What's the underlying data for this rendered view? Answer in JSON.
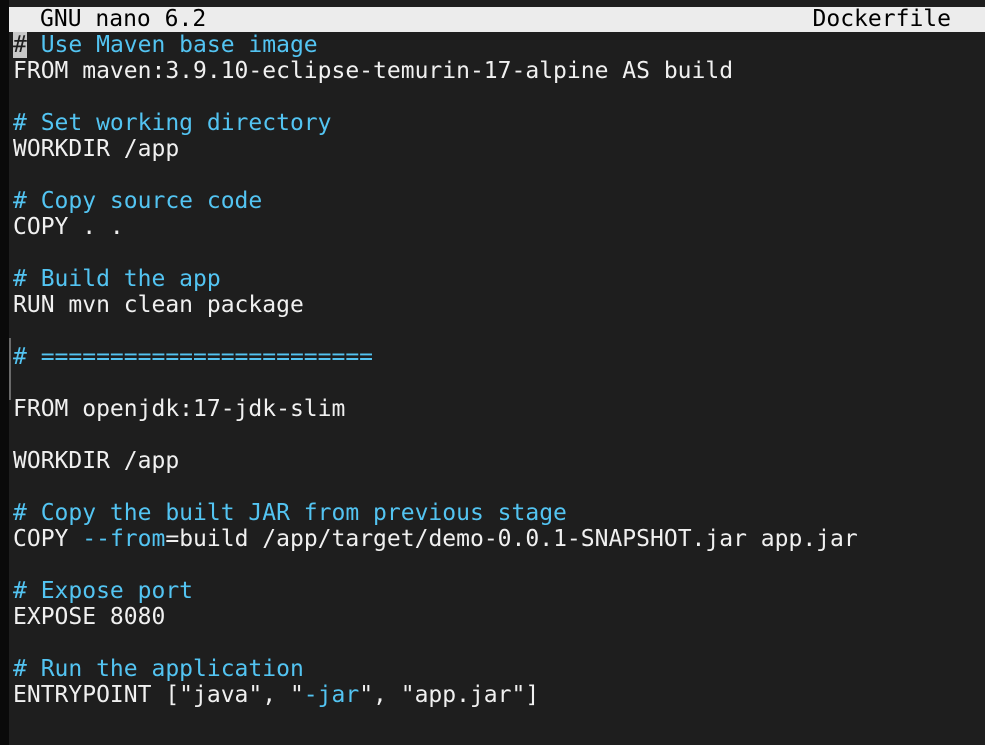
{
  "title_bar": {
    "app": "GNU nano 6.2",
    "file": "Dockerfile"
  },
  "editor": {
    "lines": [
      {
        "type": "comment",
        "cursor": "#",
        "text": " Use Maven base image"
      },
      {
        "type": "code",
        "text": "FROM maven:3.9.10-eclipse-temurin-17-alpine AS build"
      },
      {
        "type": "blank",
        "text": ""
      },
      {
        "type": "comment",
        "text": "# Set working directory"
      },
      {
        "type": "code",
        "text": "WORKDIR /app"
      },
      {
        "type": "blank",
        "text": ""
      },
      {
        "type": "comment",
        "text": "# Copy source code"
      },
      {
        "type": "code",
        "text": "COPY . ."
      },
      {
        "type": "blank",
        "text": ""
      },
      {
        "type": "comment",
        "text": "# Build the app"
      },
      {
        "type": "code",
        "text": "RUN mvn clean package"
      },
      {
        "type": "blank",
        "text": ""
      },
      {
        "type": "comment",
        "text": "# ========================"
      },
      {
        "type": "blank",
        "text": ""
      },
      {
        "type": "code",
        "text": "FROM openjdk:17-jdk-slim"
      },
      {
        "type": "blank",
        "text": ""
      },
      {
        "type": "code",
        "text": "WORKDIR /app"
      },
      {
        "type": "blank",
        "text": ""
      },
      {
        "type": "comment",
        "text": "# Copy the built JAR from previous stage"
      },
      {
        "type": "code-flag",
        "pre": "COPY ",
        "flag": "--from",
        "post": "=build /app/target/demo-0.0.1-SNAPSHOT.jar app.jar"
      },
      {
        "type": "blank",
        "text": ""
      },
      {
        "type": "comment",
        "text": "# Expose port"
      },
      {
        "type": "code",
        "text": "EXPOSE 8080"
      },
      {
        "type": "blank",
        "text": ""
      },
      {
        "type": "comment",
        "text": "# Run the application"
      },
      {
        "type": "code-flag",
        "pre": "ENTRYPOINT [\"java\", \"",
        "flag": "-jar",
        "post": "\", \"app.jar\"]"
      }
    ]
  },
  "colors": {
    "background": "#1e1e1e",
    "foreground": "#f0f0f0",
    "comment": "#53c4f2",
    "title_bar": "#ececec"
  }
}
